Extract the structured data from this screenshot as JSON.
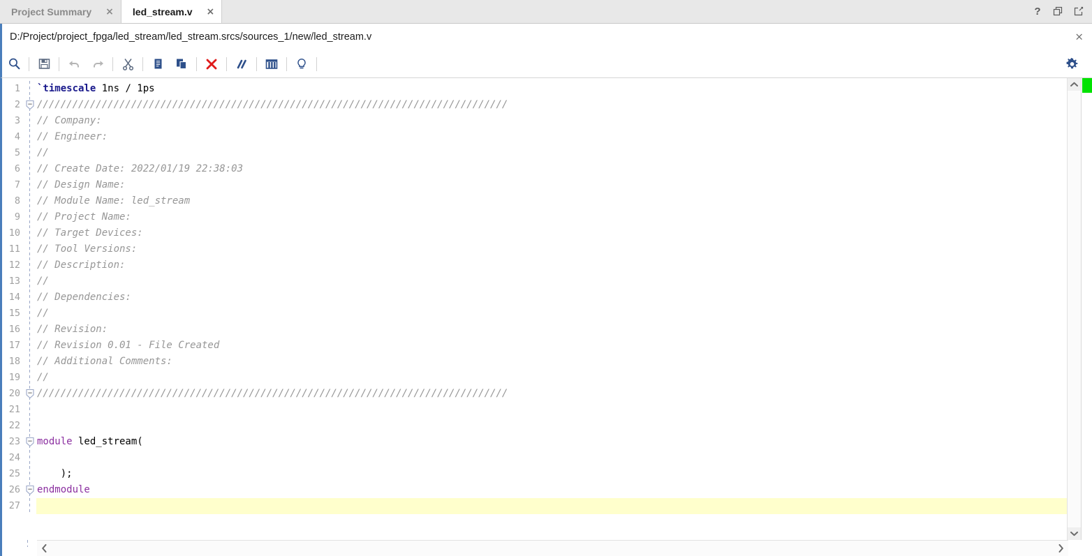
{
  "window": {
    "controls": [
      {
        "name": "help-icon",
        "label": "?"
      },
      {
        "name": "restore-window-icon",
        "label": ""
      },
      {
        "name": "float-window-icon",
        "label": ""
      }
    ]
  },
  "tabs": [
    {
      "label": "Project Summary",
      "active": false,
      "close": "×"
    },
    {
      "label": "led_stream.v",
      "active": true,
      "close": "×"
    }
  ],
  "pathbar": {
    "path": "D:/Project/project_fpga/led_stream/led_stream.srcs/sources_1/new/led_stream.v",
    "close": "×"
  },
  "toolbar": {
    "buttons": [
      {
        "name": "find-button",
        "icon": "search-icon",
        "tooltip": "Find"
      },
      {
        "name": "save-button",
        "icon": "save-icon",
        "tooltip": "Save File"
      },
      {
        "name": "undo-button",
        "icon": "undo-icon",
        "tooltip": "Undo",
        "disabled": true
      },
      {
        "name": "redo-button",
        "icon": "redo-icon",
        "tooltip": "Redo",
        "disabled": true
      },
      {
        "name": "cut-button",
        "icon": "scissors-icon",
        "tooltip": "Cut"
      },
      {
        "name": "copy-button",
        "icon": "copy-icon",
        "tooltip": "Copy"
      },
      {
        "name": "paste-button",
        "icon": "paste-icon",
        "tooltip": "Paste"
      },
      {
        "name": "delete-button",
        "icon": "red-x-icon",
        "tooltip": "Delete"
      },
      {
        "name": "toggle-comment-button",
        "icon": "double-slash-icon",
        "tooltip": "Toggle Comment"
      },
      {
        "name": "column-select-button",
        "icon": "columns-icon",
        "tooltip": "Column Selection"
      },
      {
        "name": "hints-button",
        "icon": "lightbulb-icon",
        "tooltip": "Show Hints"
      }
    ],
    "settings": {
      "name": "settings-button",
      "icon": "gear-icon",
      "tooltip": "Settings"
    }
  },
  "editor": {
    "total_lines": 27,
    "current_line": 27,
    "fold_lines": [
      2,
      20,
      23,
      26
    ],
    "lines": [
      {
        "n": 1,
        "tokens": [
          {
            "t": "`timescale",
            "c": "directive"
          },
          {
            "t": " 1ns / 1ps",
            "c": "plain"
          }
        ]
      },
      {
        "n": 2,
        "tokens": [
          {
            "t": "////////////////////////////////////////////////////////////////////////////////",
            "c": "comment"
          }
        ]
      },
      {
        "n": 3,
        "tokens": [
          {
            "t": "// Company: ",
            "c": "comment"
          }
        ]
      },
      {
        "n": 4,
        "tokens": [
          {
            "t": "// Engineer: ",
            "c": "comment"
          }
        ]
      },
      {
        "n": 5,
        "tokens": [
          {
            "t": "// ",
            "c": "comment"
          }
        ]
      },
      {
        "n": 6,
        "tokens": [
          {
            "t": "// Create Date: 2022/01/19 22:38:03",
            "c": "comment"
          }
        ]
      },
      {
        "n": 7,
        "tokens": [
          {
            "t": "// Design Name: ",
            "c": "comment"
          }
        ]
      },
      {
        "n": 8,
        "tokens": [
          {
            "t": "// Module Name: led_stream",
            "c": "comment"
          }
        ]
      },
      {
        "n": 9,
        "tokens": [
          {
            "t": "// Project Name: ",
            "c": "comment"
          }
        ]
      },
      {
        "n": 10,
        "tokens": [
          {
            "t": "// Target Devices: ",
            "c": "comment"
          }
        ]
      },
      {
        "n": 11,
        "tokens": [
          {
            "t": "// Tool Versions: ",
            "c": "comment"
          }
        ]
      },
      {
        "n": 12,
        "tokens": [
          {
            "t": "// Description: ",
            "c": "comment"
          }
        ]
      },
      {
        "n": 13,
        "tokens": [
          {
            "t": "// ",
            "c": "comment"
          }
        ]
      },
      {
        "n": 14,
        "tokens": [
          {
            "t": "// Dependencies: ",
            "c": "comment"
          }
        ]
      },
      {
        "n": 15,
        "tokens": [
          {
            "t": "// ",
            "c": "comment"
          }
        ]
      },
      {
        "n": 16,
        "tokens": [
          {
            "t": "// Revision:",
            "c": "comment"
          }
        ]
      },
      {
        "n": 17,
        "tokens": [
          {
            "t": "// Revision 0.01 - File Created",
            "c": "comment"
          }
        ]
      },
      {
        "n": 18,
        "tokens": [
          {
            "t": "// Additional Comments:",
            "c": "comment"
          }
        ]
      },
      {
        "n": 19,
        "tokens": [
          {
            "t": "// ",
            "c": "comment"
          }
        ]
      },
      {
        "n": 20,
        "tokens": [
          {
            "t": "////////////////////////////////////////////////////////////////////////////////",
            "c": "comment"
          }
        ]
      },
      {
        "n": 21,
        "tokens": []
      },
      {
        "n": 22,
        "tokens": []
      },
      {
        "n": 23,
        "tokens": [
          {
            "t": "module",
            "c": "keyword"
          },
          {
            "t": " led_stream(",
            "c": "plain"
          }
        ]
      },
      {
        "n": 24,
        "tokens": []
      },
      {
        "n": 25,
        "tokens": [
          {
            "t": "    );",
            "c": "plain"
          }
        ]
      },
      {
        "n": 26,
        "tokens": [
          {
            "t": "endmodule",
            "c": "keyword"
          }
        ]
      },
      {
        "n": 27,
        "tokens": [],
        "highlight": true
      }
    ]
  },
  "scrollbars": {
    "vertical": {
      "up": "⌃",
      "down": "⌄"
    },
    "horizontal": {
      "left": "‹",
      "right": "›"
    },
    "marker_color": "#00e200"
  },
  "colors": {
    "accent_blue": "#4a7ebb",
    "keyword_purple": "#8b2fa0",
    "directive_navy": "#1a1a8c",
    "comment_gray": "#969696",
    "current_line": "#ffffcc",
    "icon_blue": "#2d4f8a",
    "delete_red": "#e01b1b"
  }
}
